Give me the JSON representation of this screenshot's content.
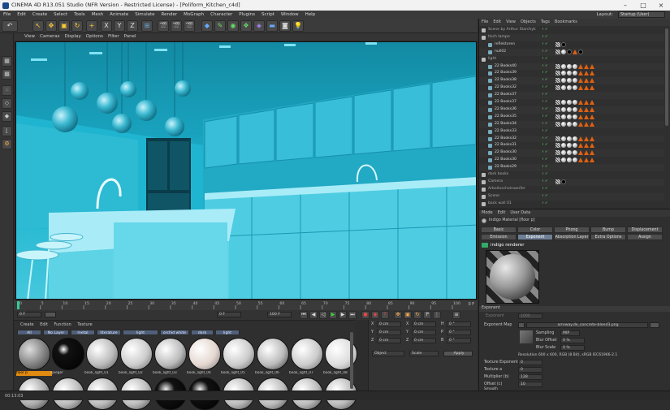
{
  "window": {
    "title": "CINEMA 4D R13.051 Studio (NFR Version - Restricted License) - [Poliform_Kitchen_c4d]",
    "controls": [
      "–",
      "□",
      "×"
    ]
  },
  "menubar": {
    "items": [
      "File",
      "Edit",
      "Create",
      "Select",
      "Tools",
      "Mesh",
      "Animate",
      "Simulate",
      "Render",
      "MoGraph",
      "Character",
      "Plugins",
      "Script",
      "Window",
      "Help"
    ],
    "layout_label": "Layout:",
    "layout_value": "Startup (User)"
  },
  "viewport_menu": [
    "View",
    "Cameras",
    "Display",
    "Options",
    "Filter",
    "Panel"
  ],
  "timeline": {
    "ticks": [
      "0",
      "5",
      "10",
      "15",
      "20",
      "25",
      "30",
      "35",
      "40",
      "45",
      "50",
      "55",
      "60",
      "65",
      "70",
      "75",
      "80",
      "85",
      "90",
      "95",
      "100"
    ],
    "frame_right": "0 F",
    "start_frame": "0 F",
    "field_a": "0 F",
    "end_frame": "100 F",
    "field_b": "100 F"
  },
  "material_manager": {
    "menu": [
      "Create",
      "Edit",
      "Function",
      "Texture"
    ],
    "filters": [
      "All",
      "No Layer",
      "metal",
      "literature",
      "light",
      "orchid white",
      "dark",
      "light"
    ],
    "row1": [
      "floor p",
      "spieger",
      "book_light_01",
      "book_light_02",
      "book_light_03",
      "book_light_04",
      "book_light_05",
      "book_light_06",
      "book_light_07",
      "book_light_08"
    ],
    "selected": "floor p"
  },
  "coord_manager": {
    "rows": [
      {
        "a": "X",
        "av": "0 cm",
        "b": "X",
        "bv": "0 cm",
        "c": "H",
        "cv": "0 °"
      },
      {
        "a": "Y",
        "av": "0 cm",
        "b": "Y",
        "bv": "0 cm",
        "c": "P",
        "cv": "0 °"
      },
      {
        "a": "Z",
        "av": "0 cm",
        "b": "Z",
        "bv": "0 cm",
        "c": "B",
        "cv": "0 °"
      }
    ],
    "mode_a": "Object",
    "mode_b": "Scale",
    "apply": "Apply"
  },
  "object_manager": {
    "menu": [
      "File",
      "Edit",
      "View",
      "Objects",
      "Tags",
      "Bookmarks"
    ],
    "rows": [
      {
        "name": "Scene by Arthur Starchyk",
        "indent": 0,
        "color": "#aaa"
      },
      {
        "name": "tisch lampe",
        "indent": 0,
        "color": "#aaa"
      },
      {
        "name": "reflektoren",
        "indent": 1,
        "color": "#ccc"
      },
      {
        "name": "null02",
        "indent": 1,
        "color": "#ccc"
      },
      {
        "name": "light",
        "indent": 0,
        "color": "#aaa"
      },
      {
        "name": "22 Books40",
        "indent": 1,
        "color": "#ddd"
      },
      {
        "name": "22 Books39",
        "indent": 1,
        "color": "#ddd"
      },
      {
        "name": "22 Books38",
        "indent": 1,
        "color": "#ddd"
      },
      {
        "name": "22 Books32",
        "indent": 1,
        "color": "#ddd"
      },
      {
        "name": "22 Books37",
        "indent": 1,
        "color": "#ddd"
      },
      {
        "name": "22 Books37",
        "indent": 1,
        "color": "#ddd"
      },
      {
        "name": "22 Books36",
        "indent": 1,
        "color": "#ddd"
      },
      {
        "name": "22 Books35",
        "indent": 1,
        "color": "#ddd"
      },
      {
        "name": "22 Books34",
        "indent": 1,
        "color": "#ddd"
      },
      {
        "name": "22 Books33",
        "indent": 1,
        "color": "#ddd"
      },
      {
        "name": "22 Books32",
        "indent": 1,
        "color": "#ddd"
      },
      {
        "name": "22 Books31",
        "indent": 1,
        "color": "#ddd"
      },
      {
        "name": "22 Books30",
        "indent": 1,
        "color": "#ddd"
      },
      {
        "name": "22 Books30",
        "indent": 1,
        "color": "#ddd"
      },
      {
        "name": "22 Books29",
        "indent": 1,
        "color": "#ddd"
      },
      {
        "name": "dark books",
        "indent": 0,
        "color": "#aaa"
      },
      {
        "name": "Camera",
        "indent": 0,
        "color": "#aaa"
      },
      {
        "name": "Arbeitsscheinwerfer",
        "indent": 0,
        "color": "#aaa"
      },
      {
        "name": "Scene",
        "indent": 0,
        "color": "#aaa"
      },
      {
        "name": "back wall 01",
        "indent": 0,
        "color": "#aaa"
      }
    ]
  },
  "attribute_manager": {
    "menu": [
      "Mode",
      "Edit",
      "User Data"
    ],
    "material_title": "Indigo Material [floor p]",
    "tabs_row1": [
      "Basic",
      "Color",
      "Phong",
      "Bump",
      "Displacement"
    ],
    "tabs_row2": [
      "Emission",
      "Exponent",
      "Absorption Layer",
      "Extra Options",
      "Assign"
    ],
    "active_tab": "Exponent",
    "renderer_label": "indigo renderer",
    "section": "Exponent",
    "exponent_label": "Exponent",
    "exponent_value": "1000",
    "exponent_map_label": "Exponent Map",
    "exponent_map_file": "arroway.de_concrete-blend3.png",
    "sampling_label": "Sampling",
    "sampling_value": "MIP",
    "blur_offset_label": "Blur Offset",
    "blur_offset_value": "0 %",
    "blur_scale_label": "Blur Scale",
    "blur_scale_value": "0 %",
    "resolution": "Resolution 600 x 600, RGB (8 Bit), sRGB IEC61966-2.1",
    "texture_exponent_label": "Texture Exponent",
    "texture_exponent_value": "0",
    "texture_a_label": "Texture a",
    "texture_a_value": "0",
    "multiplier_label": "Multiplier (b)",
    "multiplier_value": "128",
    "offset_label": "Offset (c)",
    "offset_value": "10",
    "smooth_label": "Smooth"
  },
  "status": {
    "time": "00:13:03"
  }
}
